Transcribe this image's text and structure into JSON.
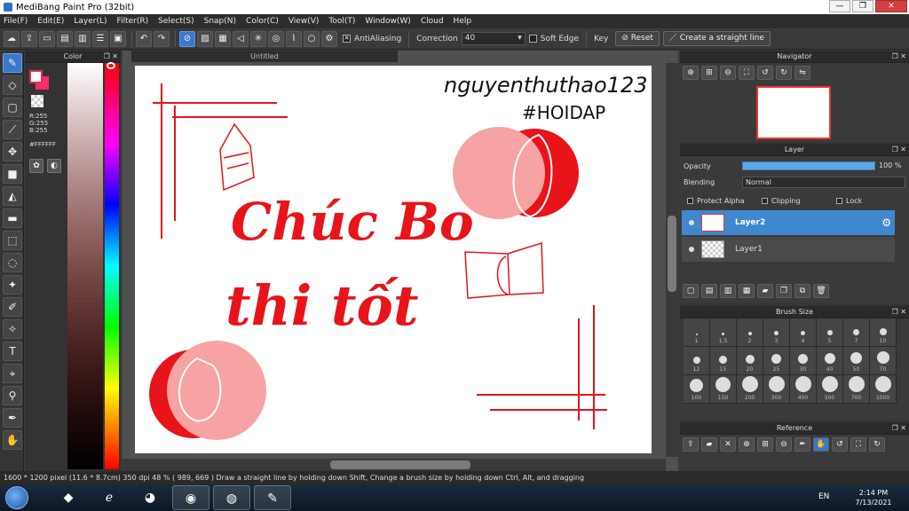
{
  "window": {
    "title": "MediBang Paint Pro (32bit)",
    "controls": [
      "—",
      "❐",
      "✕"
    ]
  },
  "menu": [
    "File(F)",
    "Edit(E)",
    "Layer(L)",
    "Filter(R)",
    "Select(S)",
    "Snap(N)",
    "Color(C)",
    "View(V)",
    "Tool(T)",
    "Window(W)",
    "Cloud",
    "Help"
  ],
  "toolbar": {
    "antialias_label": "AntiAliasing",
    "antialias_check": "✕",
    "correction_label": "Correction",
    "correction_value": "40",
    "soft_edge_label": "Soft Edge",
    "key_label": "Key",
    "reset_label": "Reset",
    "straight_line_label": "Create a straight line"
  },
  "color_panel": {
    "title": "Color",
    "r": "R:255",
    "g": "G:255",
    "b": "B:255",
    "hex": "#FFFFFF",
    "foreground": "#ffffff",
    "background": "#ff2a6a"
  },
  "document": {
    "tab_title": "Untitled",
    "artwork_text": {
      "username": "nguyenthuthao123",
      "hashtag": "#HOIDAP",
      "line1": "Chúc Bo",
      "line2": "thi tốt"
    },
    "accent_color": "#e8141a",
    "pink_color": "#f7a3a3"
  },
  "navigator": {
    "title": "Navigator"
  },
  "layer_panel": {
    "title": "Layer",
    "opacity_label": "Opacity",
    "opacity_value": "100 %",
    "opacity_percent": 100,
    "blending_label": "Blending",
    "blending_value": "Normal",
    "protect_alpha_label": "Protect Alpha",
    "clipping_label": "Clipping",
    "lock_label": "Lock",
    "layers": [
      {
        "name": "Layer2",
        "selected": true
      },
      {
        "name": "Layer1",
        "selected": false
      }
    ]
  },
  "brush_size": {
    "title": "Brush Size",
    "sizes": [
      "1",
      "1.5",
      "2",
      "3",
      "4",
      "5",
      "7",
      "10",
      "12",
      "15",
      "20",
      "25",
      "30",
      "40",
      "50",
      "70",
      "100",
      "150",
      "200",
      "300",
      "400",
      "500",
      "700",
      "1000"
    ]
  },
  "reference": {
    "title": "Reference"
  },
  "status": {
    "text": "1600 * 1200 pixel   (11.6 * 8.7cm)   350 dpi   48 %   ( 989, 669 )   Draw a straight line by holding down Shift, Change a brush size by holding down Ctrl, Alt, and dragging"
  },
  "taskbar": {
    "language": "EN",
    "time": "2:14 PM",
    "date": "7/13/2021"
  }
}
